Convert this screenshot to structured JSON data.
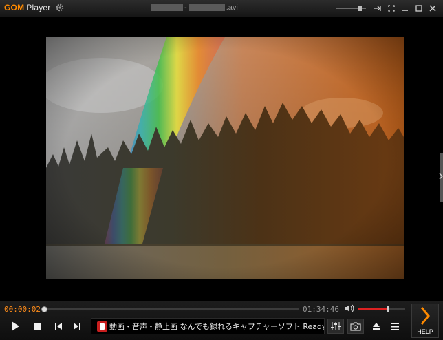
{
  "app": {
    "logo_text": "GOM",
    "logo_suffix": "Player",
    "file_extension": ".avi"
  },
  "title_controls": {
    "icons": [
      "minimize-icon",
      "always-on-top-icon",
      "fullscreen-icon",
      "minimize-window-icon",
      "maximize-icon",
      "close-icon"
    ]
  },
  "playback": {
    "current_time": "00:00:02",
    "total_time": "01:34:46",
    "progress": 0.0004,
    "volume": 0.63
  },
  "ticker": {
    "text": "動画・音声・静止画 なんでも録れるキャプチャーソフト Readygo ..."
  },
  "help_label": "HELP",
  "colors": {
    "accent": "#ff8a00",
    "volume_fill": "#dd2222"
  }
}
